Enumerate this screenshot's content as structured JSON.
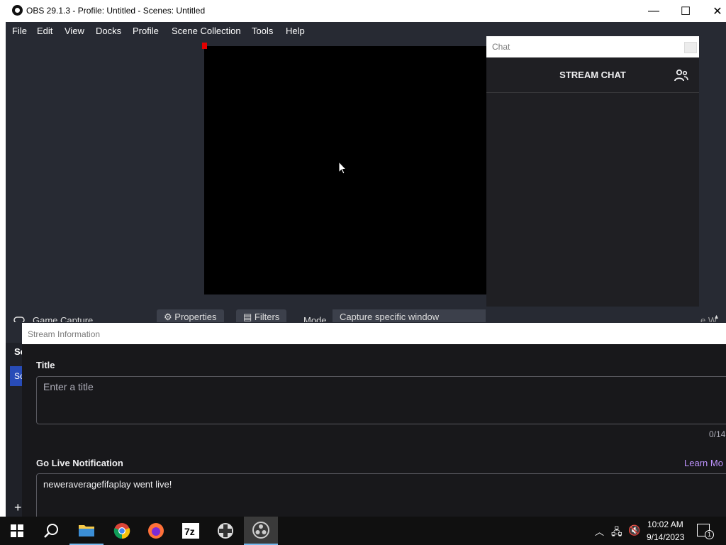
{
  "window": {
    "title": "OBS 29.1.3 - Profile: Untitled - Scenes: Untitled",
    "minimize": "—",
    "maximize": "☐",
    "close": "✕"
  },
  "menu": {
    "items": [
      {
        "label": "File"
      },
      {
        "label": "Edit"
      },
      {
        "label": "View"
      },
      {
        "label": "Docks"
      },
      {
        "label": "Profile"
      },
      {
        "label": "Scene Collection"
      },
      {
        "label": "Tools"
      },
      {
        "label": "Help"
      }
    ]
  },
  "chat_dock": {
    "window_title": "Chat",
    "header": "STREAM CHAT",
    "users_icon": "users-icon"
  },
  "source_toolbar": {
    "source_name": "Game Capture",
    "properties_label": "Properties",
    "filters_label": "Filters",
    "mode_label": "Mode",
    "mode_value": "Capture specific window",
    "right_fragment": "e W"
  },
  "scenes": {
    "label": "Sc",
    "item": "Sc",
    "add": "+"
  },
  "stream_info": {
    "window_title": "Stream Information",
    "title_label": "Title",
    "title_placeholder": "Enter a title",
    "title_counter": "0/14",
    "notification_label": "Go Live Notification",
    "learn_more": "Learn Mo",
    "notification_value": "neweraveragefifaplay went live!"
  },
  "taskbar": {
    "apps": [
      "start-icon",
      "search-icon",
      "file-explorer-icon",
      "chrome-icon",
      "firefox-icon",
      "7zip-icon",
      "app-icon",
      "obs-icon"
    ],
    "time": "10:02 AM",
    "date": "9/14/2023",
    "notification_count": "1"
  },
  "colors": {
    "obs_bg": "#272a33",
    "twitch_bg": "#18181b",
    "accent": "#bf94ff",
    "selected_scene": "#284cb8"
  }
}
